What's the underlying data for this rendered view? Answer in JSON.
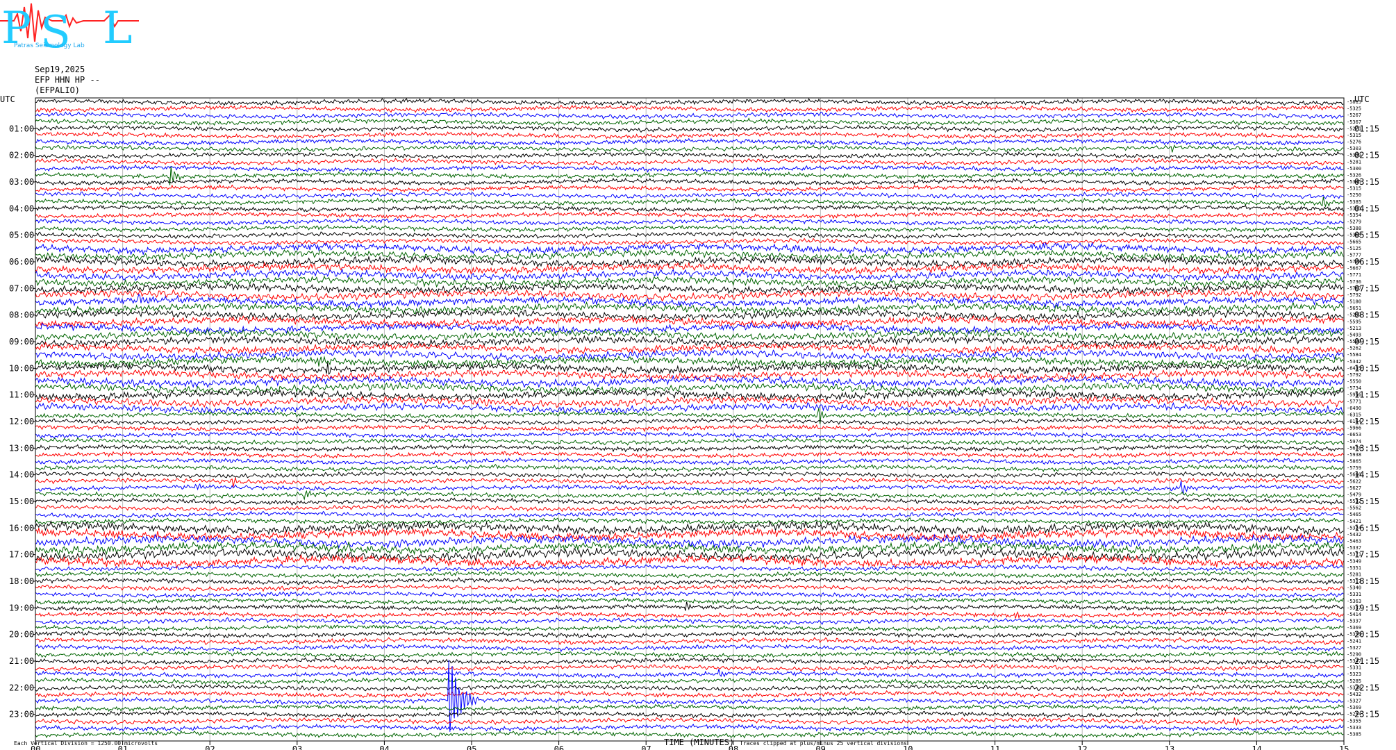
{
  "header": {
    "date": "Sep19,2025",
    "station": "EFP HHN HP --",
    "site": "(EFPALIO)"
  },
  "logo": {
    "text_p": "P",
    "text_s": "S",
    "text_l": "L",
    "text_sub": "Patras Seismology Lab"
  },
  "colors": {
    "black": "#000000",
    "red": "#ff0000",
    "blue": "#0000ff",
    "green": "#006400",
    "grid": "#bbbbbb"
  },
  "chart_data": {
    "type": "line",
    "title": "",
    "xlabel": "TIME (MINUTES)",
    "ylabel": "UTC",
    "right_axis_label": "UTC",
    "xlim": [
      0,
      15
    ],
    "x_ticks": [
      "00",
      "01",
      "02",
      "03",
      "04",
      "05",
      "06",
      "07",
      "08",
      "09",
      "10",
      "11",
      "12",
      "13",
      "14",
      "15"
    ],
    "left_ticks": [
      "01:00",
      "02:00",
      "03:00",
      "04:00",
      "05:00",
      "06:00",
      "07:00",
      "08:00",
      "09:00",
      "10:00",
      "11:00",
      "12:00",
      "13:00",
      "14:00",
      "15:00",
      "16:00",
      "17:00",
      "18:00",
      "19:00",
      "20:00",
      "21:00",
      "22:00",
      "23:00"
    ],
    "right_ticks": [
      "01:15",
      "02:15",
      "03:15",
      "04:15",
      "05:15",
      "06:15",
      "07:15",
      "08:15",
      "09:15",
      "10:15",
      "11:15",
      "12:15",
      "13:15",
      "14:15",
      "15:15",
      "16:15",
      "17:15",
      "18:15",
      "19:15",
      "20:15",
      "21:15",
      "22:15",
      "23:15"
    ],
    "trace_interval_minutes": 15,
    "trace_count": 96,
    "trace_colors": [
      "black",
      "red",
      "blue",
      "green"
    ],
    "offsets": [
      "-5813",
      "-5325",
      "-5267",
      "-5367",
      "-5271",
      "-5315",
      "-5276",
      "-5303",
      "-5339",
      "-5281",
      "-5300",
      "-5326",
      "-5345",
      "-5315",
      "-5250",
      "-5385",
      "-5331",
      "-5354",
      "-5279",
      "-5388",
      "-5365",
      "-5665",
      "-5125",
      "-5777",
      "-5728",
      "-5667",
      "-5771",
      "-5736",
      "-5767",
      "-5792",
      "-5180",
      "-5651",
      "-5297",
      "-5595",
      "-5213",
      "-5493",
      "-5520",
      "-5262",
      "-5584",
      "-5342",
      "-6435",
      "-5792",
      "-5550",
      "-5734",
      "-5956",
      "-5771",
      "-6490",
      "-6315",
      "-6164",
      "-5966",
      "-6653",
      "-5974",
      "-5678",
      "-5938",
      "-5865",
      "-5759",
      "-5660",
      "-5622",
      "-5627",
      "-5479",
      "-5532",
      "-5562",
      "-5465",
      "-5421",
      "-5324",
      "-5432",
      "-5463",
      "-5337",
      "-5371",
      "-5349",
      "-5351",
      "-5281",
      "-5317",
      "-5340",
      "-5331",
      "-5363",
      "-5337",
      "-5414",
      "-5337",
      "-5369",
      "-5356",
      "-5241",
      "-5327",
      "-5290",
      "-5347",
      "-5331",
      "-5323",
      "-5285",
      "-5338",
      "-5432",
      "-5327",
      "-5369",
      "-5254",
      "-5355",
      "-5333",
      "-5385",
      "-5387"
    ],
    "events": [
      {
        "trace": 11,
        "minute": 1.55,
        "amp": 3.5
      },
      {
        "trace": 15,
        "minute": 14.75,
        "amp": 1.5
      },
      {
        "trace": 7,
        "minute": 13.05,
        "amp": 0.8
      },
      {
        "trace": 30,
        "minute": 1.2,
        "amp": 2.0
      },
      {
        "trace": 40,
        "minute": 3.35,
        "amp": 2.5
      },
      {
        "trace": 39,
        "minute": 3.25,
        "amp": 1.2
      },
      {
        "trace": 47,
        "minute": 8.98,
        "amp": 3.0
      },
      {
        "trace": 57,
        "minute": 2.25,
        "amp": 1.5
      },
      {
        "trace": 58,
        "minute": 1.85,
        "amp": 1.0
      },
      {
        "trace": 59,
        "minute": 7.6,
        "amp": 1.2
      },
      {
        "trace": 59,
        "minute": 3.1,
        "amp": 1.3
      },
      {
        "trace": 58,
        "minute": 13.15,
        "amp": 2.0
      },
      {
        "trace": 67,
        "minute": 3.6,
        "amp": 2.0
      },
      {
        "trace": 76,
        "minute": 7.45,
        "amp": 1.3
      },
      {
        "trace": 77,
        "minute": 11.25,
        "amp": 0.8
      },
      {
        "trace": 86,
        "minute": 7.85,
        "amp": 0.9
      },
      {
        "trace": 90,
        "minute": 4.75,
        "amp": 12.0
      },
      {
        "trace": 93,
        "minute": 13.75,
        "amp": 1.0
      }
    ]
  },
  "footer": {
    "scale_note": "Each Vertical Division = 1250.00 microvolts",
    "axis_title": "TIME (MINUTES)",
    "clip_note": "Traces clipped at plus/minus 25 vertical divisions"
  }
}
